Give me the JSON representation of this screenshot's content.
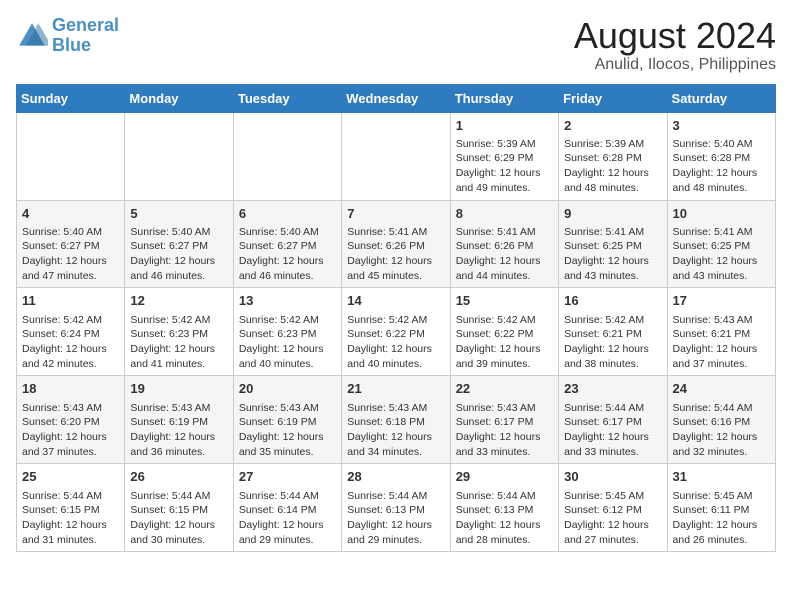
{
  "logo": {
    "line1": "General",
    "line2": "Blue"
  },
  "title": "August 2024",
  "subtitle": "Anulid, Ilocos, Philippines",
  "days_of_week": [
    "Sunday",
    "Monday",
    "Tuesday",
    "Wednesday",
    "Thursday",
    "Friday",
    "Saturday"
  ],
  "weeks": [
    [
      {
        "day": "",
        "info": ""
      },
      {
        "day": "",
        "info": ""
      },
      {
        "day": "",
        "info": ""
      },
      {
        "day": "",
        "info": ""
      },
      {
        "day": "1",
        "info": "Sunrise: 5:39 AM\nSunset: 6:29 PM\nDaylight: 12 hours\nand 49 minutes."
      },
      {
        "day": "2",
        "info": "Sunrise: 5:39 AM\nSunset: 6:28 PM\nDaylight: 12 hours\nand 48 minutes."
      },
      {
        "day": "3",
        "info": "Sunrise: 5:40 AM\nSunset: 6:28 PM\nDaylight: 12 hours\nand 48 minutes."
      }
    ],
    [
      {
        "day": "4",
        "info": "Sunrise: 5:40 AM\nSunset: 6:27 PM\nDaylight: 12 hours\nand 47 minutes."
      },
      {
        "day": "5",
        "info": "Sunrise: 5:40 AM\nSunset: 6:27 PM\nDaylight: 12 hours\nand 46 minutes."
      },
      {
        "day": "6",
        "info": "Sunrise: 5:40 AM\nSunset: 6:27 PM\nDaylight: 12 hours\nand 46 minutes."
      },
      {
        "day": "7",
        "info": "Sunrise: 5:41 AM\nSunset: 6:26 PM\nDaylight: 12 hours\nand 45 minutes."
      },
      {
        "day": "8",
        "info": "Sunrise: 5:41 AM\nSunset: 6:26 PM\nDaylight: 12 hours\nand 44 minutes."
      },
      {
        "day": "9",
        "info": "Sunrise: 5:41 AM\nSunset: 6:25 PM\nDaylight: 12 hours\nand 43 minutes."
      },
      {
        "day": "10",
        "info": "Sunrise: 5:41 AM\nSunset: 6:25 PM\nDaylight: 12 hours\nand 43 minutes."
      }
    ],
    [
      {
        "day": "11",
        "info": "Sunrise: 5:42 AM\nSunset: 6:24 PM\nDaylight: 12 hours\nand 42 minutes."
      },
      {
        "day": "12",
        "info": "Sunrise: 5:42 AM\nSunset: 6:23 PM\nDaylight: 12 hours\nand 41 minutes."
      },
      {
        "day": "13",
        "info": "Sunrise: 5:42 AM\nSunset: 6:23 PM\nDaylight: 12 hours\nand 40 minutes."
      },
      {
        "day": "14",
        "info": "Sunrise: 5:42 AM\nSunset: 6:22 PM\nDaylight: 12 hours\nand 40 minutes."
      },
      {
        "day": "15",
        "info": "Sunrise: 5:42 AM\nSunset: 6:22 PM\nDaylight: 12 hours\nand 39 minutes."
      },
      {
        "day": "16",
        "info": "Sunrise: 5:42 AM\nSunset: 6:21 PM\nDaylight: 12 hours\nand 38 minutes."
      },
      {
        "day": "17",
        "info": "Sunrise: 5:43 AM\nSunset: 6:21 PM\nDaylight: 12 hours\nand 37 minutes."
      }
    ],
    [
      {
        "day": "18",
        "info": "Sunrise: 5:43 AM\nSunset: 6:20 PM\nDaylight: 12 hours\nand 37 minutes."
      },
      {
        "day": "19",
        "info": "Sunrise: 5:43 AM\nSunset: 6:19 PM\nDaylight: 12 hours\nand 36 minutes."
      },
      {
        "day": "20",
        "info": "Sunrise: 5:43 AM\nSunset: 6:19 PM\nDaylight: 12 hours\nand 35 minutes."
      },
      {
        "day": "21",
        "info": "Sunrise: 5:43 AM\nSunset: 6:18 PM\nDaylight: 12 hours\nand 34 minutes."
      },
      {
        "day": "22",
        "info": "Sunrise: 5:43 AM\nSunset: 6:17 PM\nDaylight: 12 hours\nand 33 minutes."
      },
      {
        "day": "23",
        "info": "Sunrise: 5:44 AM\nSunset: 6:17 PM\nDaylight: 12 hours\nand 33 minutes."
      },
      {
        "day": "24",
        "info": "Sunrise: 5:44 AM\nSunset: 6:16 PM\nDaylight: 12 hours\nand 32 minutes."
      }
    ],
    [
      {
        "day": "25",
        "info": "Sunrise: 5:44 AM\nSunset: 6:15 PM\nDaylight: 12 hours\nand 31 minutes."
      },
      {
        "day": "26",
        "info": "Sunrise: 5:44 AM\nSunset: 6:15 PM\nDaylight: 12 hours\nand 30 minutes."
      },
      {
        "day": "27",
        "info": "Sunrise: 5:44 AM\nSunset: 6:14 PM\nDaylight: 12 hours\nand 29 minutes."
      },
      {
        "day": "28",
        "info": "Sunrise: 5:44 AM\nSunset: 6:13 PM\nDaylight: 12 hours\nand 29 minutes."
      },
      {
        "day": "29",
        "info": "Sunrise: 5:44 AM\nSunset: 6:13 PM\nDaylight: 12 hours\nand 28 minutes."
      },
      {
        "day": "30",
        "info": "Sunrise: 5:45 AM\nSunset: 6:12 PM\nDaylight: 12 hours\nand 27 minutes."
      },
      {
        "day": "31",
        "info": "Sunrise: 5:45 AM\nSunset: 6:11 PM\nDaylight: 12 hours\nand 26 minutes."
      }
    ]
  ]
}
